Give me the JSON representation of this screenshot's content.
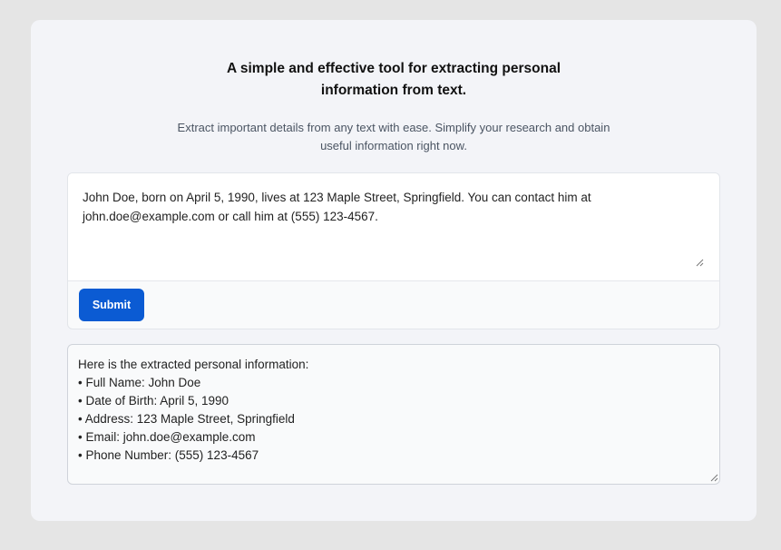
{
  "header": {
    "title": "A simple and effective tool for extracting personal information from text.",
    "subtitle": "Extract important details from any text with ease. Simplify your research and obtain useful information right now."
  },
  "input": {
    "value": "John Doe, born on April 5, 1990, lives at 123 Maple Street, Springfield. You can contact him at john.doe@example.com or call him at (555) 123-4567."
  },
  "toolbar": {
    "submit_label": "Submit"
  },
  "output": {
    "lines": [
      "Here is the extracted personal information:",
      "• Full Name: John Doe",
      "• Date of Birth: April 5, 1990",
      "• Address: 123 Maple Street, Springfield",
      "• Email: john.doe@example.com",
      "• Phone Number: (555) 123-4567"
    ]
  },
  "colors": {
    "background": "#e5e5e5",
    "card": "#f3f4f8",
    "accent": "#0b5bd3"
  }
}
